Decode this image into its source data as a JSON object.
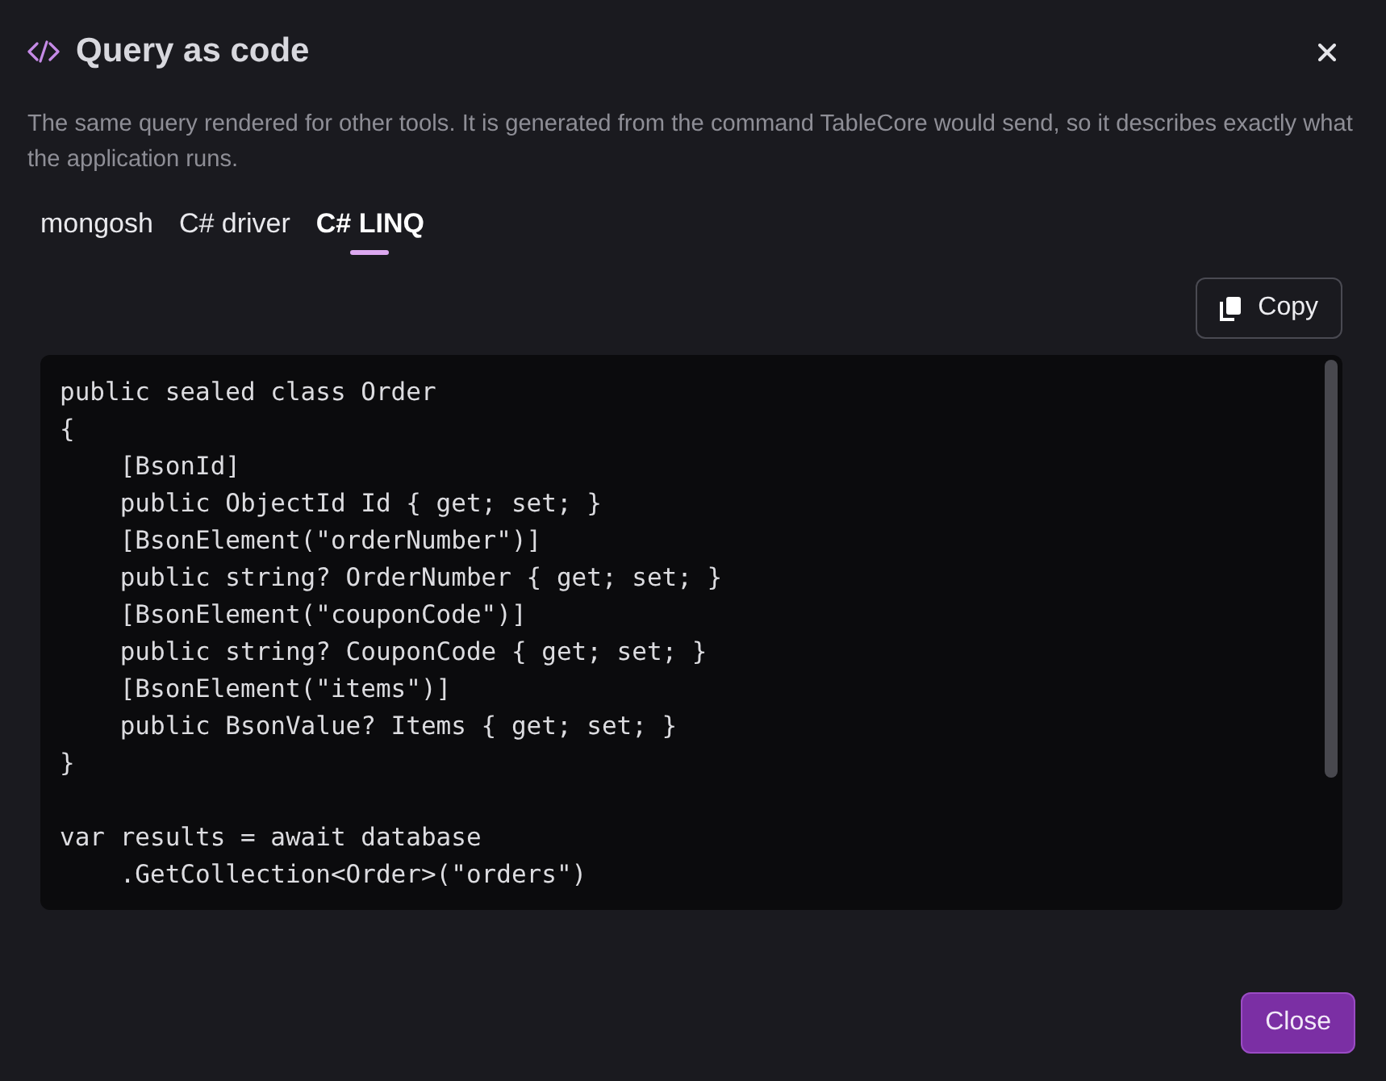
{
  "dialog": {
    "title": "Query as code",
    "description": "The same query rendered for other tools. It is generated from the command TableCore would send, so it describes exactly what the application runs."
  },
  "tabs": [
    {
      "label": "mongosh",
      "selected": false
    },
    {
      "label": "C# driver",
      "selected": false
    },
    {
      "label": "C# LINQ",
      "selected": true
    }
  ],
  "copy_button": "Copy",
  "code_blocks": [
    [
      "public sealed class Order",
      "{",
      "    [BsonId]",
      "    public ObjectId Id { get; set; }",
      "    [BsonElement(\"orderNumber\")]",
      "    public string? OrderNumber { get; set; }",
      "    [BsonElement(\"couponCode\")]",
      "    public string? CouponCode { get; set; }",
      "    [BsonElement(\"items\")]",
      "    public BsonValue? Items { get; set; }",
      "}"
    ],
    [
      "var results = await database",
      "    .GetCollection<Order>(\"orders\")"
    ]
  ],
  "footer_button": "Close"
}
